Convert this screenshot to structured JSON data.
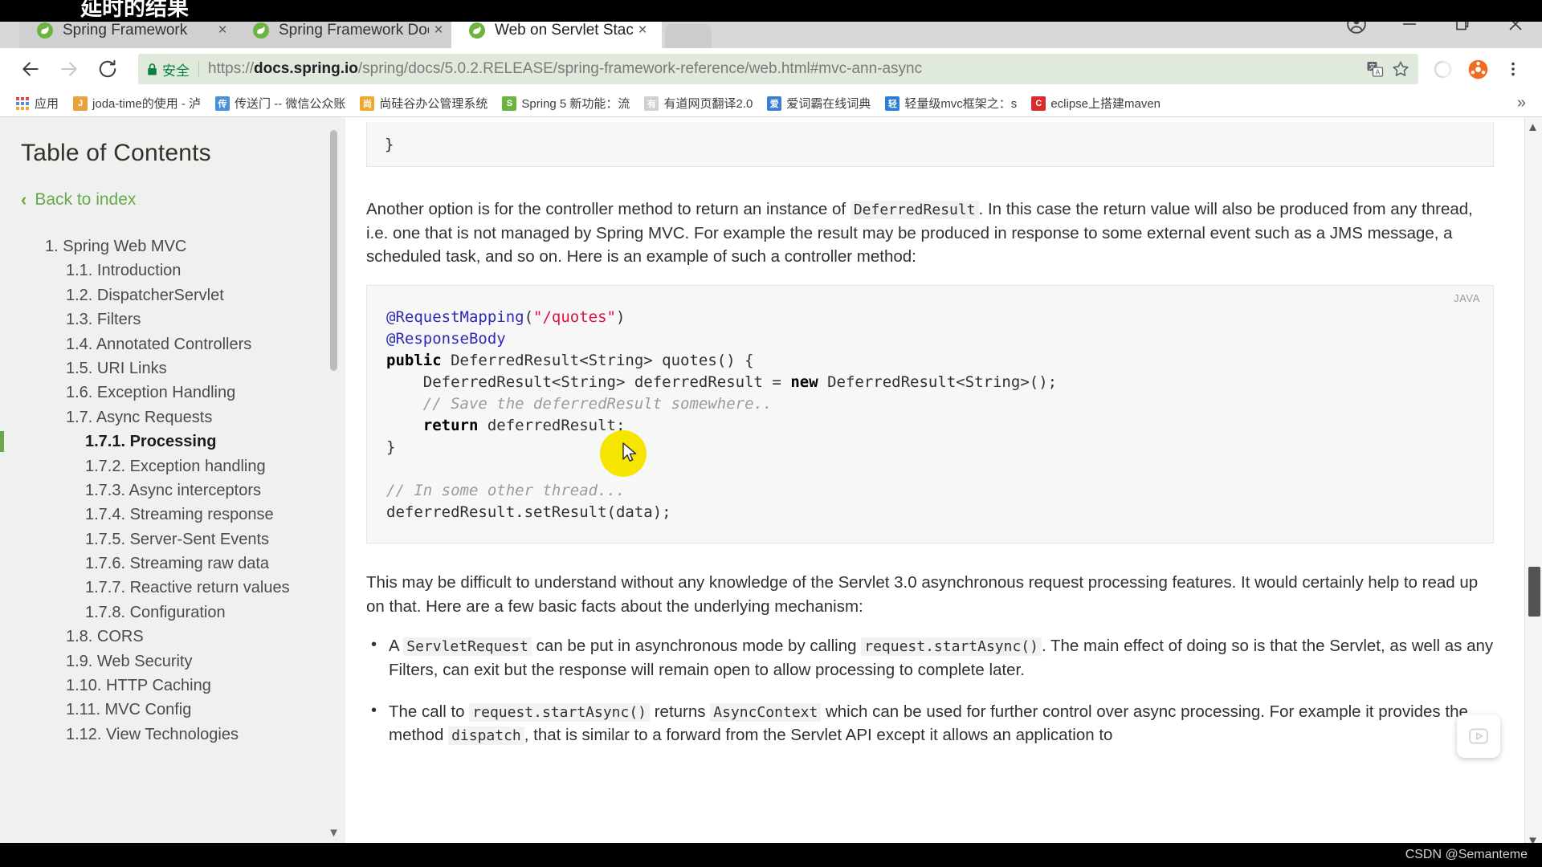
{
  "overlay": {
    "top_caption": "延时的结果",
    "watermark": "CSDN @Semanteme"
  },
  "browser": {
    "tabs": [
      {
        "title": "Spring Framework",
        "favicon": "spring-leaf-icon",
        "close": "×",
        "active": false
      },
      {
        "title": "Spring Framework Doc",
        "favicon": "spring-leaf-icon",
        "close": "×",
        "active": false
      },
      {
        "title": "Web on Servlet Stack",
        "favicon": "spring-leaf-icon",
        "close": "×",
        "active": true
      }
    ],
    "window_controls": {
      "profile": "profile-avatar-icon",
      "minimize": "minimize-icon",
      "maximize": "restore-icon",
      "close": "close-icon"
    },
    "toolbar": {
      "back": "back-arrow-icon",
      "forward": "forward-arrow-icon",
      "reload": "reload-icon",
      "security_label": "安全",
      "url_scheme": "https://",
      "url_host": "docs.spring.io",
      "url_path": "/spring/docs/5.0.2.RELEASE/spring-framework-reference/web.html#mvc-ann-async",
      "translate": "translate-icon",
      "bookmark_star": "star-icon",
      "extension_1": "extension-circle-icon",
      "extension_2": "extension-orange-icon",
      "menu": "three-dot-menu-icon"
    },
    "bookmarks": {
      "apps_label": "应用",
      "items": [
        {
          "label": "joda-time的使用 - 泸",
          "icon_text": "J",
          "icon_color": "#e8a33d"
        },
        {
          "label": "传送门 -- 微信公众账",
          "icon_text": "传",
          "icon_color": "#4a90d9"
        },
        {
          "label": "尚硅谷办公管理系统",
          "icon_text": "尚",
          "icon_color": "#f0a830"
        },
        {
          "label": "Spring 5 新功能：流",
          "icon_text": "S",
          "icon_color": "#6db33f"
        },
        {
          "label": "有道网页翻译2.0",
          "icon_text": "有",
          "icon_color": "#d0d0d0"
        },
        {
          "label": "爱词霸在线词典",
          "icon_text": "爱",
          "icon_color": "#3b7fd4"
        },
        {
          "label": "轻量级mvc框架之：s",
          "icon_text": "轻",
          "icon_color": "#2a7fd4"
        },
        {
          "label": "eclipse上搭建maven",
          "icon_text": "C",
          "icon_color": "#d92b2b"
        }
      ],
      "overflow": "»"
    }
  },
  "sidebar": {
    "title": "Table of Contents",
    "back_to_index": "Back to index",
    "back_chevron": "‹",
    "items": [
      {
        "label": "1. Spring Web MVC",
        "level": 1,
        "current": false
      },
      {
        "label": "1.1. Introduction",
        "level": 2,
        "current": false
      },
      {
        "label": "1.2. DispatcherServlet",
        "level": 2,
        "current": false
      },
      {
        "label": "1.3. Filters",
        "level": 2,
        "current": false
      },
      {
        "label": "1.4. Annotated Controllers",
        "level": 2,
        "current": false
      },
      {
        "label": "1.5. URI Links",
        "level": 2,
        "current": false
      },
      {
        "label": "1.6. Exception Handling",
        "level": 2,
        "current": false
      },
      {
        "label": "1.7. Async Requests",
        "level": 2,
        "current": false
      },
      {
        "label": "1.7.1. Processing",
        "level": 3,
        "current": true
      },
      {
        "label": "1.7.2. Exception handling",
        "level": 3,
        "current": false
      },
      {
        "label": "1.7.3. Async interceptors",
        "level": 3,
        "current": false
      },
      {
        "label": "1.7.4. Streaming response",
        "level": 3,
        "current": false
      },
      {
        "label": "1.7.5. Server-Sent Events",
        "level": 3,
        "current": false
      },
      {
        "label": "1.7.6. Streaming raw data",
        "level": 3,
        "current": false
      },
      {
        "label": "1.7.7. Reactive return values",
        "level": 3,
        "current": false
      },
      {
        "label": "1.7.8. Configuration",
        "level": 3,
        "current": false
      },
      {
        "label": "1.8. CORS",
        "level": 2,
        "current": false
      },
      {
        "label": "1.9. Web Security",
        "level": 2,
        "current": false
      },
      {
        "label": "1.10. HTTP Caching",
        "level": 2,
        "current": false
      },
      {
        "label": "1.11. MVC Config",
        "level": 2,
        "current": false
      },
      {
        "label": "1.12. View Technologies",
        "level": 2,
        "current": false
      }
    ],
    "scroll_down_arrow": "▼"
  },
  "content": {
    "prev_code_tail": "}",
    "para1_a": "Another option is for the controller method to return an instance of ",
    "para1_code": "DeferredResult",
    "para1_b": ". In this case the return value will also be produced from any thread, i.e. one that is not managed by Spring MVC. For example the result may be produced in response to some external event such as a JMS message, a scheduled task, and so on. Here is an example of such a controller method:",
    "code_lang": "JAVA",
    "code_lines": [
      {
        "segments": [
          {
            "t": "@RequestMapping",
            "c": "ann"
          },
          {
            "t": "(",
            "c": ""
          },
          {
            "t": "\"/quotes\"",
            "c": "str"
          },
          {
            "t": ")",
            "c": ""
          }
        ]
      },
      {
        "segments": [
          {
            "t": "@ResponseBody",
            "c": "ann"
          }
        ]
      },
      {
        "segments": [
          {
            "t": "public",
            "c": "k"
          },
          {
            "t": " DeferredResult<String> quotes() {",
            "c": ""
          }
        ]
      },
      {
        "segments": [
          {
            "t": "    DeferredResult<String> deferredResult = ",
            "c": ""
          },
          {
            "t": "new",
            "c": "k"
          },
          {
            "t": " DeferredResult<String>();",
            "c": ""
          }
        ]
      },
      {
        "segments": [
          {
            "t": "    // Save the deferredResult somewhere..",
            "c": "cm"
          }
        ]
      },
      {
        "segments": [
          {
            "t": "    ",
            "c": ""
          },
          {
            "t": "return",
            "c": "k"
          },
          {
            "t": " deferredResult;",
            "c": ""
          }
        ]
      },
      {
        "segments": [
          {
            "t": "}",
            "c": ""
          }
        ]
      },
      {
        "segments": [
          {
            "t": "",
            "c": ""
          }
        ]
      },
      {
        "segments": [
          {
            "t": "// In some other thread...",
            "c": "cm"
          }
        ]
      },
      {
        "segments": [
          {
            "t": "deferredResult.setResult(data);",
            "c": ""
          }
        ]
      }
    ],
    "para2": "This may be difficult to understand without any knowledge of the Servlet 3.0 asynchronous request processing features. It would certainly help to read up on that. Here are a few basic facts about the underlying mechanism:",
    "bullets": [
      {
        "parts": [
          {
            "t": "A ",
            "code": false
          },
          {
            "t": "ServletRequest",
            "code": true
          },
          {
            "t": " can be put in asynchronous mode by calling ",
            "code": false
          },
          {
            "t": "request.startAsync()",
            "code": true
          },
          {
            "t": ". The main effect of doing so is that the Servlet, as well as any Filters, can exit but the response will remain open to allow processing to complete later.",
            "code": false
          }
        ]
      },
      {
        "parts": [
          {
            "t": "The call to ",
            "code": false
          },
          {
            "t": "request.startAsync()",
            "code": true
          },
          {
            "t": " returns ",
            "code": false
          },
          {
            "t": "AsyncContext",
            "code": true
          },
          {
            "t": " which can be used for further control over async processing. For example it provides the method ",
            "code": false
          },
          {
            "t": "dispatch",
            "code": true
          },
          {
            "t": ", that is similar to a forward from the Servlet API except it allows an application to",
            "code": false
          }
        ]
      }
    ]
  },
  "widgets": {
    "play_widget": "play-button-icon"
  },
  "colors": {
    "accent_green": "#6aa84f",
    "secure_green": "#0b8043",
    "omnibox_bg": "#dfeadd",
    "sidebar_bg": "#eef1ee",
    "code_bg": "#f7f7f7",
    "cursor_yellow": "#f5e500",
    "string_red": "#d14",
    "annotation_blue": "#2b2bb5"
  }
}
